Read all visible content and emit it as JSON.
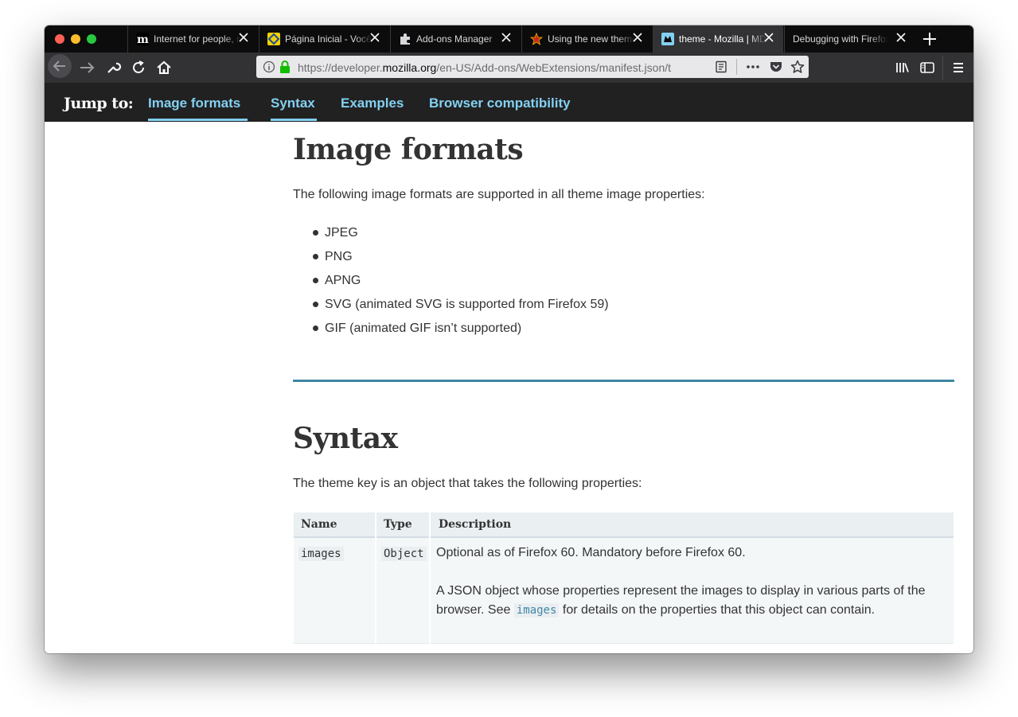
{
  "browser": {
    "tabs": [
      {
        "title": "Internet for people, no",
        "favicon": "mozilla-m-icon",
        "active": false
      },
      {
        "title": "Página Inicial - Você",
        "favicon": "banco-do-brasil-icon",
        "active": false
      },
      {
        "title": "Add-ons Manager",
        "favicon": "puzzle-piece-icon",
        "active": false
      },
      {
        "title": "Using the new theme",
        "favicon": "star-icon",
        "active": false
      },
      {
        "title": "theme - Mozilla | MDN",
        "favicon": "mdn-icon",
        "active": true
      },
      {
        "title": "Debugging with Firefox D",
        "favicon": "none",
        "active": false
      }
    ],
    "url": {
      "prefix": "https://developer.",
      "domain": "mozilla.org",
      "path": "/en-US/Add-ons/WebExtensions/manifest.json/t"
    }
  },
  "jumpbar": {
    "label": "Jump to:",
    "links": [
      {
        "label": "Image formats"
      },
      {
        "label": "Syntax"
      },
      {
        "label": "Examples"
      },
      {
        "label": "Browser compatibility"
      }
    ]
  },
  "image_formats": {
    "heading": "Image formats",
    "intro": "The following image formats are supported in all theme image properties:",
    "items": [
      "JPEG",
      "PNG",
      "APNG",
      "SVG (animated SVG is supported from Firefox 59)",
      "GIF (animated GIF isn’t supported)"
    ]
  },
  "syntax": {
    "heading": "Syntax",
    "intro": "The theme key is an object that takes the following properties:",
    "table": {
      "headers": [
        "Name",
        "Type",
        "Description"
      ],
      "rows": [
        {
          "name": "images",
          "type": "Object",
          "desc_line1": "Optional as of Firefox 60. Mandatory before Firefox 60.",
          "desc_line2": "A JSON object whose properties represent the images to display in various parts of the",
          "desc_line3_before": "browser. See",
          "desc_line3_code": "images",
          "desc_line3_after": "for details on the properties that this object can contain."
        }
      ]
    }
  },
  "colors": {
    "accent": "#83d0f2",
    "rule": "#3f87a6"
  }
}
